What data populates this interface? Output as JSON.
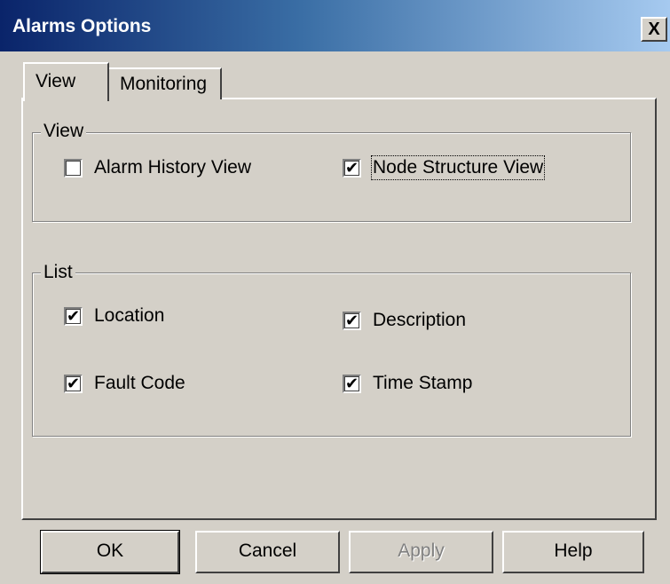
{
  "window": {
    "title": "Alarms Options",
    "close_glyph": "X",
    "titlebar_colors": [
      "#0a246a",
      "#a6caf0"
    ]
  },
  "tabs": [
    {
      "label": "View",
      "selected": true
    },
    {
      "label": "Monitoring",
      "selected": false
    }
  ],
  "groups": {
    "view": {
      "label": "View",
      "items": [
        {
          "label": "Alarm History View",
          "checked": false,
          "mark": ""
        },
        {
          "label": "Node Structure View",
          "checked": true,
          "mark": "✔"
        }
      ]
    },
    "list": {
      "label": "List",
      "items": [
        {
          "label": "Location",
          "checked": true,
          "mark": "✔"
        },
        {
          "label": "Description",
          "checked": true,
          "mark": "✔"
        },
        {
          "label": "Fault Code",
          "checked": true,
          "mark": "✔"
        },
        {
          "label": "Time Stamp",
          "checked": true,
          "mark": "✔"
        }
      ]
    }
  },
  "buttons": {
    "ok": "OK",
    "cancel": "Cancel",
    "apply": "Apply",
    "help": "Help"
  }
}
